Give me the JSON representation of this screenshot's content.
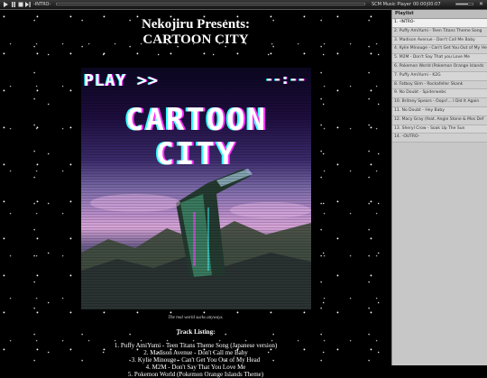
{
  "player": {
    "current_track": "-INTRO-",
    "title": "SCM Music Player",
    "time": "00:00|00:07",
    "progress": 0.0,
    "volume": 0.7,
    "close_glyph": "✕",
    "icons": [
      "play-icon",
      "pause-icon",
      "stop-icon",
      "skip-icon",
      "close-icon"
    ]
  },
  "page": {
    "heading_line1": "Nekojiru Presents:",
    "heading_line2": "CARTOON CITY",
    "cover": {
      "play_text": "PLAY >>",
      "timer_text": "--:--",
      "title_line1": "CARTOON",
      "title_line2": "CITY"
    },
    "tagline": "The real world sucks anyways.",
    "listing_title": "Track Listing:",
    "tracks": [
      "1. Puffy AmiYumi - Teen Titans Theme Song (Japanese version)",
      "2. Madison Avenue - Don't Call me Baby",
      "3. Kylie Minouge - Can't Get You Out of My Head",
      "4. M2M - Don't Say That You Love Me",
      "5. Pokemon World (Pokemon Orange Islands Theme)"
    ]
  },
  "playlist": {
    "header": "Playlist",
    "active_index": 0,
    "items": [
      "1. -INTRO-",
      "2. Puffy AmiYumi - Teen Titans Theme Song",
      "3. Madison Avenue - Don't Call Me Baby",
      "4. Kylie Minouge - Can't Get You Out of My He",
      "5. M2M - Don't Say That you Love Me",
      "6. Pokemon World (Pokemon Orange Islands",
      "7. Puffy AmiYumi - K2G",
      "8. Fatboy Slim - Rockafeller Skank",
      "9. No Doubt - Spiderwebs",
      "10. Britney Spears - Oops!... I Did It Again",
      "11. No Doubt - Hey Baby",
      "12. Macy Gray (feat. Angie Stone & Mos Def",
      "13. Sheryl Crow - Soak Up The Sun",
      "14. -OUTRO-"
    ]
  },
  "colors": {
    "page_bg": "#000000",
    "playlist_bg": "#c7c7c7",
    "playlist_active": "#f0f0f0",
    "glitch_magenta": "#ff30ff",
    "glitch_cyan": "#30ffff"
  }
}
